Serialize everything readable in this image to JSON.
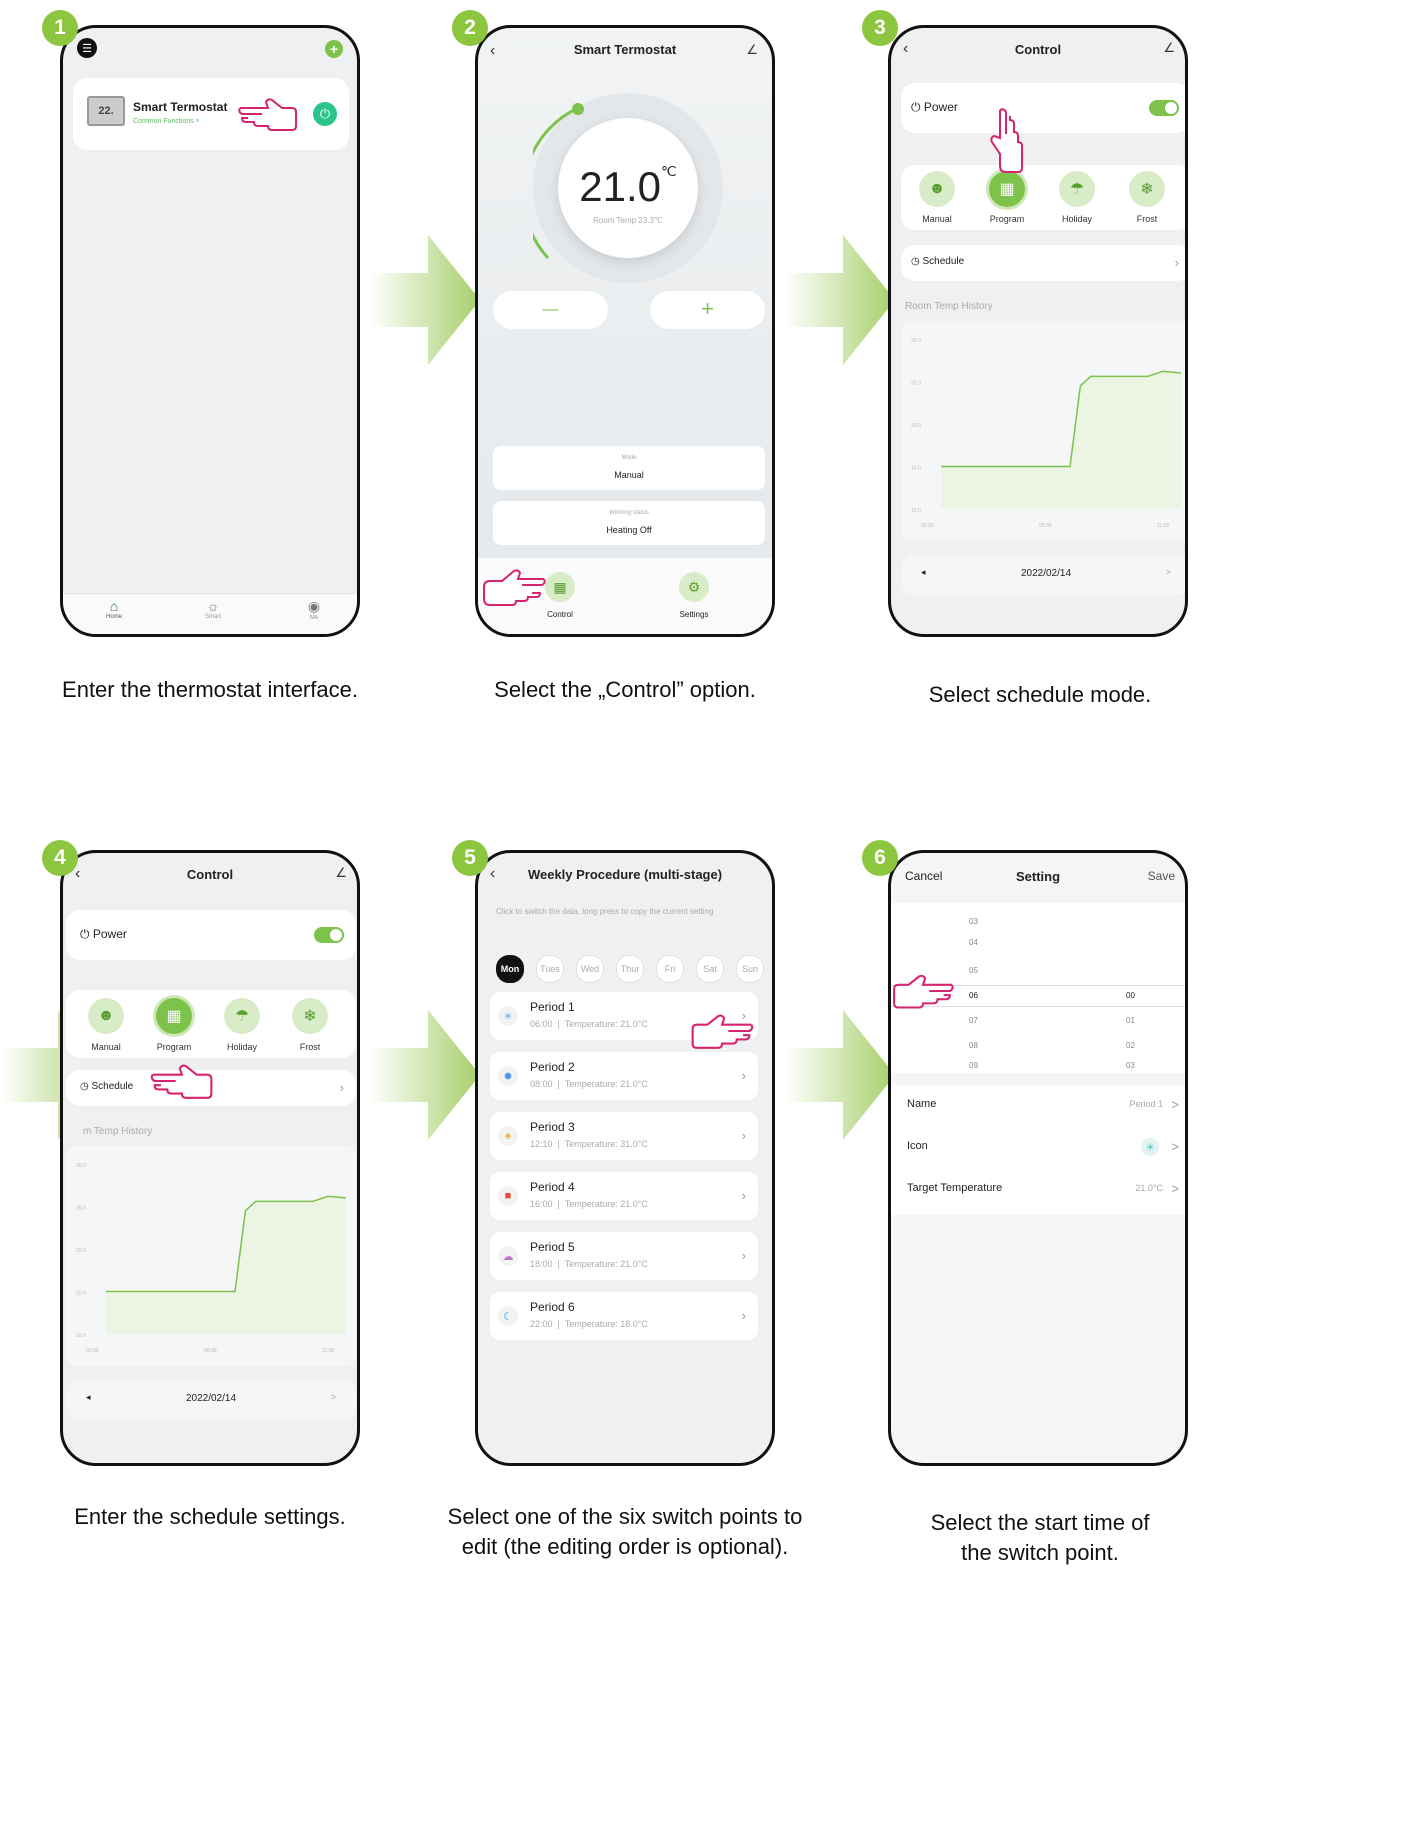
{
  "colors": {
    "accent": "#8cc63f",
    "brand_green": "#7cc24b",
    "hand": "#d6246e",
    "arrow": "#a6cf6a"
  },
  "step_badges": [
    "1",
    "2",
    "3",
    "4",
    "5",
    "6"
  ],
  "captions": {
    "s1": "Enter the thermostat interface.",
    "s2": "Select the „Control” option.",
    "s3": "Select schedule mode.",
    "s4": "Enter the schedule settings.",
    "s5_line1": "Select one of the six switch points to",
    "s5_line2": "edit (the editing order is optional).",
    "s6_line1": "Select the start time of",
    "s6_line2": "the switch point."
  },
  "screen1": {
    "device_icon_text": "22.",
    "device_name": "Smart Termostat",
    "device_sub": "Common Functions ˅",
    "tabs": [
      "Home",
      "Smart",
      "Me"
    ]
  },
  "screen2": {
    "title": "Smart Termostat",
    "temp": "21.0",
    "temp_unit": "℃",
    "room_temp": "Room Temp 23.3℃",
    "minus": "—",
    "plus": "+",
    "mode_label": "Mode",
    "mode_value": "Manual",
    "status_label": "Working status",
    "status_value": "Heating Off",
    "tabs": [
      "Control",
      "Settings"
    ]
  },
  "control": {
    "title": "Control",
    "power": "Power",
    "modes": [
      "Manual",
      "Program",
      "Holiday",
      "Frost"
    ],
    "schedule": "Schedule",
    "history": "Room Temp History",
    "history_cut": "m Temp History",
    "y_ticks": [
      "30.0",
      "25.0",
      "20.0",
      "15.0",
      "10.0"
    ],
    "x_ticks": [
      "00:00",
      "08:00",
      "11:08"
    ],
    "date": "2022/02/14",
    "prev": "◂",
    "next": ">"
  },
  "chart_data": {
    "type": "area",
    "x": [
      0,
      1,
      2,
      3,
      4,
      5,
      5.4,
      5.8,
      6.2,
      7,
      8,
      8.6,
      9.3
    ],
    "values": [
      15,
      15,
      15,
      15,
      15,
      15,
      24.5,
      25.6,
      25.6,
      25.6,
      25.6,
      26.2,
      26.0
    ],
    "y_ticks": [
      "30.0",
      "25.0",
      "20.0",
      "15.0",
      "10.0"
    ],
    "x_ticks": [
      "00:00",
      "08:00",
      "11:08"
    ]
  },
  "screen5": {
    "title": "Weekly Procedure (multi-stage)",
    "hint": "Click to switch the data, long press to copy the current setting",
    "days": [
      "Mon",
      "Tues",
      "Wed",
      "Thur",
      "Fri",
      "Sat",
      "Sun"
    ],
    "periods": [
      {
        "name": "Period 1",
        "detail": "06:00  |  Temperature: 21.0°C",
        "icon": "☀",
        "color": "#5bc0c8"
      },
      {
        "name": "Period 2",
        "detail": "08:00  |  Temperature: 21.0°C",
        "icon": "✹",
        "color": "#4a90e2"
      },
      {
        "name": "Period 3",
        "detail": "12:10  |  Temperature: 31.0°C",
        "icon": "♠",
        "color": "#f0b429"
      },
      {
        "name": "Period 4",
        "detail": "16:00  |  Temperature: 21.0°C",
        "icon": "■",
        "color": "#e74c3c"
      },
      {
        "name": "Period 5",
        "detail": "18:00  |  Temperature: 21.0°C",
        "icon": "☁",
        "color": "#c06fd0"
      },
      {
        "name": "Period 6",
        "detail": "22:00  |  Temperature: 18.0°C",
        "icon": "☾",
        "color": "#3aa6d8"
      }
    ]
  },
  "screen6": {
    "cancel": "Cancel",
    "title": "Setting",
    "save": "Save",
    "hours": [
      "03",
      "04",
      "05",
      "06",
      "07",
      "08",
      "09"
    ],
    "minutes": [
      "00",
      "01",
      "02",
      "03"
    ],
    "name_label": "Name",
    "name_value": "Period 1",
    "icon_label": "Icon",
    "target_label": "Target Temperature",
    "target_value": "21.0°C",
    "chev": ">"
  }
}
